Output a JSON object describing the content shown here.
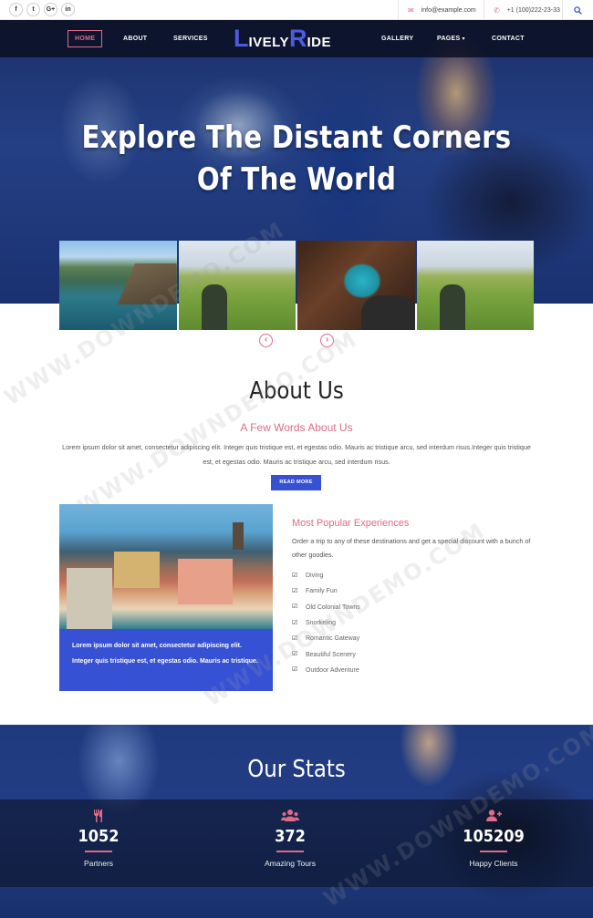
{
  "topbar": {
    "socials": [
      {
        "label": "f",
        "icon": "facebook-icon"
      },
      {
        "label": "t",
        "icon": "twitter-icon"
      },
      {
        "label": "G+",
        "icon": "google-plus-icon"
      },
      {
        "label": "in",
        "icon": "linkedin-icon"
      }
    ],
    "email": "info@example.com",
    "phone": "+1 (100)222-23-33"
  },
  "nav": {
    "home": "HOME",
    "about": "ABOUT",
    "services": "SERVICES",
    "logo_first_cap": "L",
    "logo_first_rest": "IVELY",
    "logo_second_cap": "R",
    "logo_second_rest": "IDE",
    "gallery": "GALLERY",
    "pages": "PAGES",
    "contact": "CONTACT"
  },
  "hero": {
    "title": "Explore The Distant Corners Of The World"
  },
  "about": {
    "title": "About Us",
    "subtitle": "A Few Words About Us",
    "text": "Lorem ipsum dolor sit amet, consectetur adipiscing elit. Integer quis tristique est, et egestas odio. Mauris ac tristique arcu, sed interdum risus.Integer quis tristique est, et egestas odio. Mauris ac tristique arcu, sed interdum risus.",
    "read_more": "READ MORE",
    "box_text": "Lorem ipsum dolor sit amet, consectetur adipiscing elit. Integer quis tristique est, et egestas odio. Mauris ac tristique."
  },
  "popular": {
    "title": "Most Popular Experiences",
    "text": "Order a trip to any of these destinations and get a special discount with a bunch of other goodies.",
    "items": [
      "Diving",
      "Family Fun",
      "Old Colonial Towns",
      "Snorkeling",
      "Romantic Gateway",
      "Beautiful Scenery",
      "Outdoor Adventure"
    ]
  },
  "stats": {
    "title": "Our Stats",
    "items": [
      {
        "value": "1052",
        "label": "Partners",
        "icon": "cutlery-icon"
      },
      {
        "value": "372",
        "label": "Amazing Tours",
        "icon": "users-icon"
      },
      {
        "value": "105209",
        "label": "Happy Clients",
        "icon": "user-plus-icon"
      }
    ]
  },
  "watermark": "WWW.DOWNDEMO.COM",
  "colors": {
    "accent": "#e06b86",
    "primary": "#3651d4",
    "nav_bg": "#0a0e1e"
  }
}
